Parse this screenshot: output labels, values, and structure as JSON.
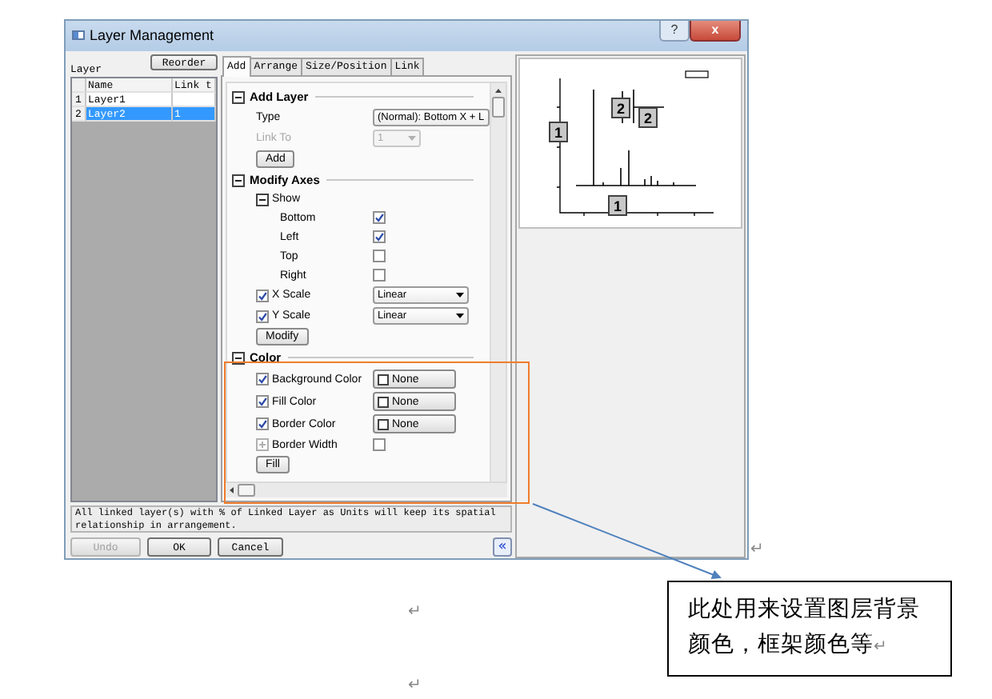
{
  "window": {
    "title": "Layer Management",
    "help_button": "?",
    "close_button": "x"
  },
  "layer_panel": {
    "label": "Layer",
    "reorder_button": "Reorder",
    "columns": [
      "Name",
      "Link t"
    ],
    "rows": [
      {
        "index": "1",
        "name": "Layer1",
        "selected": false
      },
      {
        "index": "2",
        "name": "Layer2",
        "link": "1",
        "selected": true
      }
    ]
  },
  "tabs": [
    {
      "label": "Add",
      "selected": true
    },
    {
      "label": "Arrange",
      "selected": false
    },
    {
      "label": "Size/Position",
      "selected": false
    },
    {
      "label": "Link",
      "selected": false
    }
  ],
  "tree": [
    {
      "kind": "section",
      "label": "Add Layer",
      "expanded": true,
      "children": [
        {
          "kind": "dropdown",
          "label": "Type",
          "value": "(Normal): Bottom X + L",
          "disabled": false
        },
        {
          "kind": "dropdown",
          "label": "Link To",
          "value": "1",
          "disabled": true
        },
        {
          "kind": "button",
          "label": "Add"
        }
      ]
    },
    {
      "kind": "section",
      "label": "Modify Axes",
      "expanded": true,
      "children": [
        {
          "kind": "group",
          "label": "Show",
          "expanded": true,
          "children": [
            {
              "kind": "check",
              "label": "Bottom",
              "checked": true
            },
            {
              "kind": "check",
              "label": "Left",
              "checked": true
            },
            {
              "kind": "check",
              "label": "Top",
              "checked": false
            },
            {
              "kind": "check",
              "label": "Right",
              "checked": false
            }
          ]
        },
        {
          "kind": "check_dropdown",
          "label": "X Scale",
          "checked": true,
          "value": "Linear"
        },
        {
          "kind": "check_dropdown",
          "label": "Y Scale",
          "checked": true,
          "value": "Linear"
        },
        {
          "kind": "button",
          "label": "Modify"
        }
      ]
    },
    {
      "kind": "section",
      "label": "Color",
      "expanded": true,
      "children": [
        {
          "kind": "check_color",
          "label": "Background Color",
          "checked": true,
          "value": "None"
        },
        {
          "kind": "check_color",
          "label": "Fill Color",
          "checked": true,
          "value": "None"
        },
        {
          "kind": "check_color",
          "label": "Border Color",
          "checked": true,
          "value": "None"
        },
        {
          "kind": "option",
          "label": "Border Width",
          "expanded": false,
          "checked": false
        },
        {
          "kind": "button",
          "label": "Fill"
        }
      ]
    }
  ],
  "message": "All linked layer(s) with % of Linked Layer as Units will keep its spatial relationship in arrangement.",
  "buttons": [
    {
      "label": "Undo",
      "disabled": true
    },
    {
      "label": "OK",
      "disabled": false
    },
    {
      "label": "Cancel",
      "disabled": false
    }
  ],
  "collapse_button": "«",
  "preview": {
    "layer_badges": [
      "1",
      "2",
      "2",
      "1"
    ]
  },
  "callout": {
    "text": "此处用来设置图层背景颜色，框架颜色等",
    "mark": "↵"
  },
  "paragraph_marks": [
    "↵",
    "↵",
    "↵"
  ]
}
